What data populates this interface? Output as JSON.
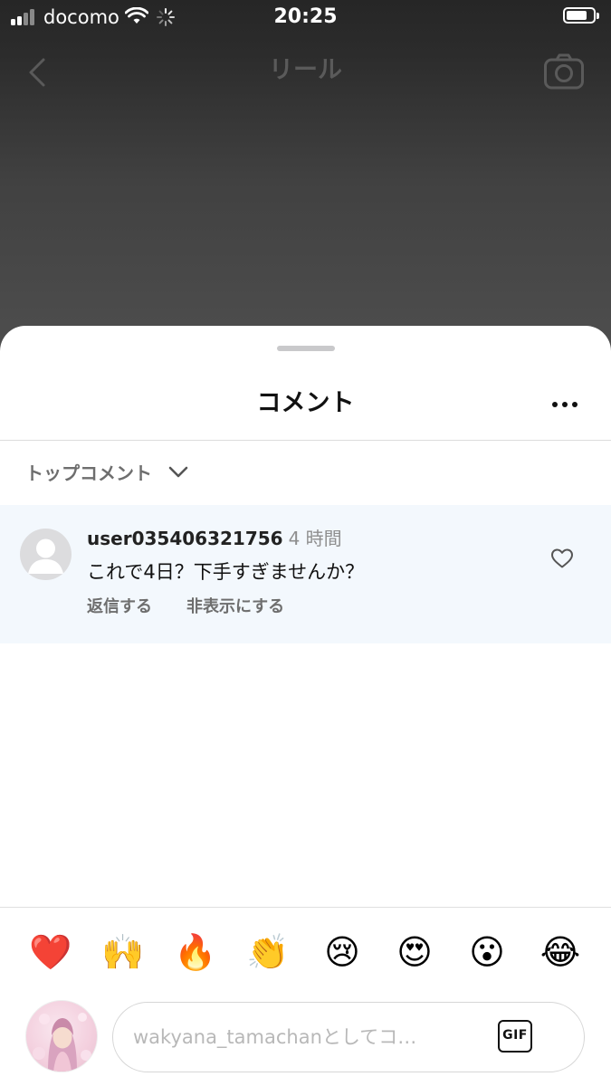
{
  "status_bar": {
    "carrier": "docomo",
    "time": "20:25",
    "battery_level": 0.8
  },
  "under_nav": {
    "title": "リール"
  },
  "sheet": {
    "title": "コメント",
    "sort_label": "トップコメント"
  },
  "comment": {
    "username": "user035406321756",
    "time_ago": "4 時間",
    "text": "これで4日？下手すぎませんか？",
    "reply_label": "返信する",
    "hide_label": "非表示にする"
  },
  "emoji_bar": [
    "❤️",
    "🙌",
    "🔥",
    "👏",
    "😢",
    "😍",
    "😮",
    "😂"
  ],
  "composer": {
    "placeholder": "wakyana_tamachanとしてコ…",
    "gif_label": "GIF"
  },
  "icons": {
    "back": "chevron-left-icon",
    "camera": "camera-icon",
    "more": "more-horizontal-icon",
    "sort": "chevron-down-icon",
    "like": "heart-outline-icon"
  }
}
